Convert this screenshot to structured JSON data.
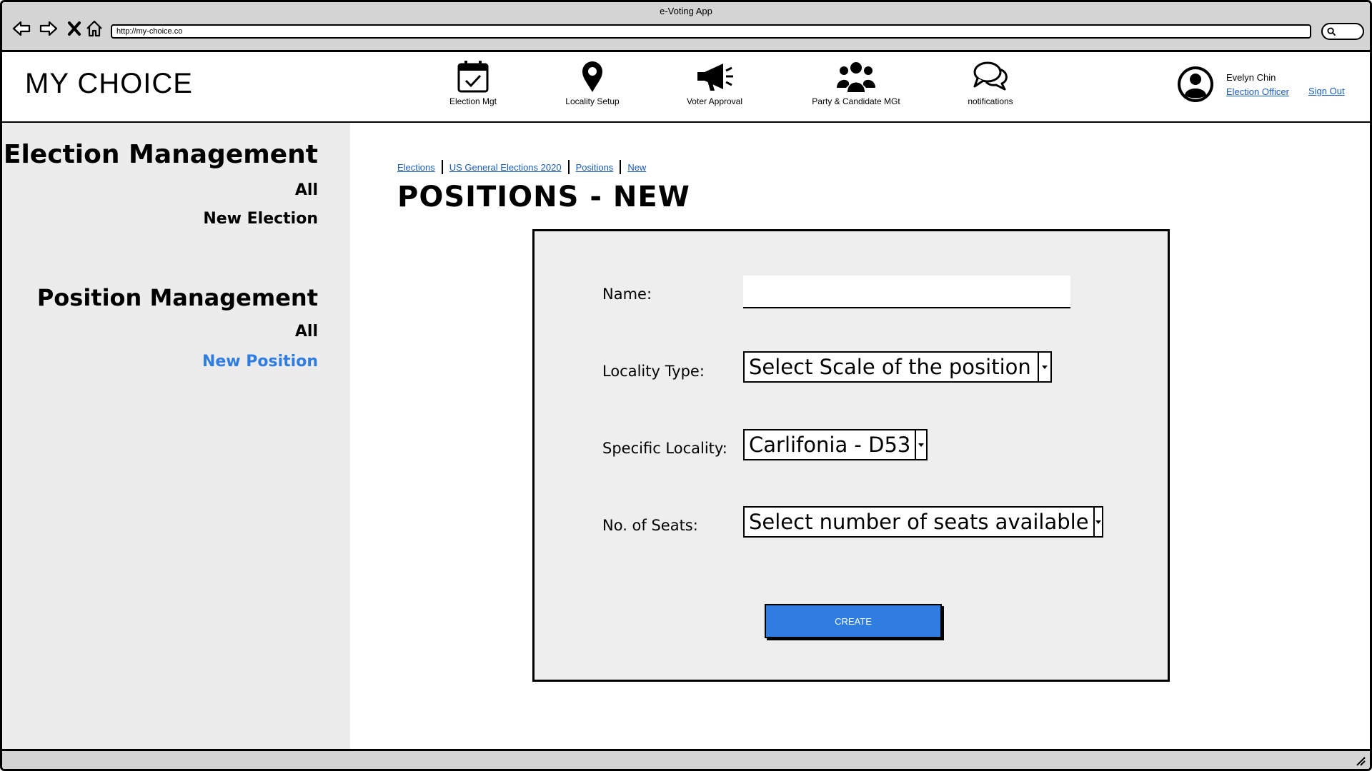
{
  "window": {
    "title": "e-Voting App",
    "url": "http://my-choice.co"
  },
  "header": {
    "brand": "MY CHOICE",
    "nav": [
      {
        "label": "Election Mgt",
        "icon": "calendar-check-icon"
      },
      {
        "label": "Locality Setup",
        "icon": "map-pin-icon"
      },
      {
        "label": "Voter Approval",
        "icon": "megaphone-icon"
      },
      {
        "label": "Party & Candidate MGt",
        "icon": "group-icon"
      },
      {
        "label": "notifications",
        "icon": "chat-bubbles-icon"
      }
    ],
    "user": {
      "name": "Evelyn Chin",
      "role": "Election Officer",
      "sign_out": "Sign Out"
    }
  },
  "sidebar": {
    "sections": [
      {
        "heading": "Election Management",
        "links": [
          "All",
          "New Election"
        ]
      },
      {
        "heading": "Position Management",
        "links": [
          "All",
          "New Position"
        ]
      }
    ],
    "active_link": "New Position"
  },
  "breadcrumb": [
    "Elections",
    "US General Elections 2020",
    "Positions",
    "New"
  ],
  "page_title": "POSITIONS - NEW",
  "form": {
    "name_label": "Name:",
    "name_value": "",
    "locality_type_label": "Locality Type:",
    "locality_type_value": "Select Scale of the position",
    "specific_locality_label": "Specific Locality:",
    "specific_locality_value": "Carlifonia - D53",
    "seats_label": "No. of Seats:",
    "seats_value": "Select number of seats available",
    "create_label": "CREATE"
  },
  "colors": {
    "accent": "#2f7de1",
    "link": "#1b5dbf",
    "sidebar_bg": "#ececec",
    "panel_bg": "#eeeeee",
    "chrome_bg": "#d4d4d4"
  }
}
